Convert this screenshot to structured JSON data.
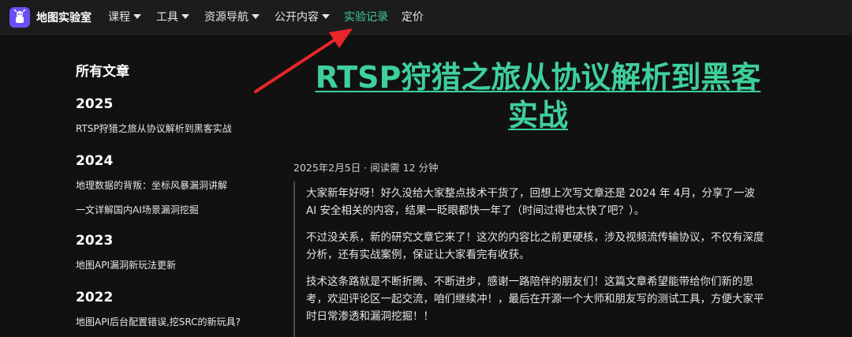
{
  "brand": {
    "name": "地图实验室",
    "icon": "lab-logo-icon"
  },
  "nav": {
    "items": [
      {
        "label": "课程",
        "dropdown": true
      },
      {
        "label": "工具",
        "dropdown": true
      },
      {
        "label": "资源导航",
        "dropdown": true
      },
      {
        "label": "公开内容",
        "dropdown": true
      },
      {
        "label": "实验记录",
        "dropdown": false,
        "active": true
      },
      {
        "label": "定价",
        "dropdown": false
      }
    ],
    "active_color": "#3fcf9b"
  },
  "sidebar": {
    "title": "所有文章",
    "groups": [
      {
        "year": "2025",
        "links": [
          "RTSP狩猎之旅从协议解析到黑客实战"
        ]
      },
      {
        "year": "2024",
        "links": [
          "地理数据的背叛：坐标风暴漏洞讲解",
          "一文详解国内AI场景漏洞挖掘"
        ]
      },
      {
        "year": "2023",
        "links": [
          "地图API漏洞新玩法更新"
        ]
      },
      {
        "year": "2022",
        "links": [
          "地图API后台配置错误,挖SRC的新玩具?"
        ]
      }
    ]
  },
  "article": {
    "title_line1": "RTSP狩猎之旅从协议解析到黑客",
    "title_line2": "实战",
    "meta": "2025年2月5日 · 阅读需 12 分钟",
    "paragraphs": [
      "大家新年好呀！好久没给大家整点技术干货了，回想上次写文章还是 2024 年 4月，分享了一波 AI 安全相关的内容，结果一眨眼都快一年了（时间过得也太快了吧？）。",
      "不过没关系，新的研究文章它来了！这次的内容比之前更硬核，涉及视频流传输协议，不仅有深度分析，还有实战案例，保证让大家看完有收获。",
      "技术这条路就是不断折腾、不断进步，感谢一路陪伴的朋友们！这篇文章希望能带给你们新的思考，欢迎评论区一起交流，咱们继续冲！，最后在开源一个大师和朋友写的测试工具，方便大家平时日常渗透和漏洞挖掘！！"
    ]
  },
  "annotation": {
    "type": "red-arrow-icon",
    "color": "#e8262a"
  }
}
